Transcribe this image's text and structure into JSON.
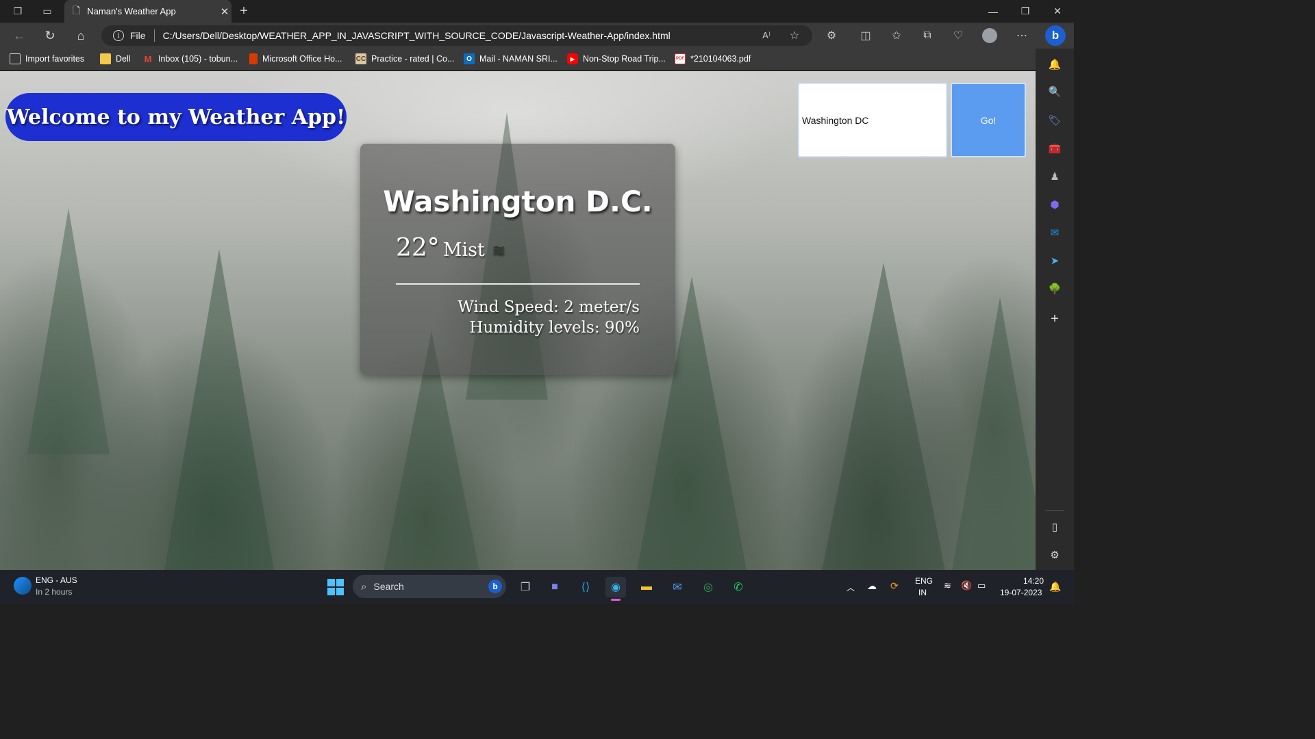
{
  "browser": {
    "tab_title": "Naman's Weather App",
    "address_scheme": "File",
    "url": "C:/Users/Dell/Desktop/WEATHER_APP_IN_JAVASCRIPT_WITH_SOURCE_CODE/Javascript-Weather-App/index.html",
    "favorites": [
      {
        "label": "Import favorites",
        "icon": "import-icon",
        "color": "#cfcfcf"
      },
      {
        "label": "Dell",
        "icon": "folder-icon",
        "color": "#f2c94c"
      },
      {
        "label": "Inbox (105) - tobun...",
        "icon": "gmail-icon",
        "color": "#ea4335"
      },
      {
        "label": "Microsoft Office Ho...",
        "icon": "office-icon",
        "color": "#d83b01"
      },
      {
        "label": "Practice - rated | Co...",
        "icon": "codechef-icon",
        "color": "#8b6b4a"
      },
      {
        "label": "Mail - NAMAN SRI...",
        "icon": "outlook-icon",
        "color": "#0f6cbd"
      },
      {
        "label": "Non-Stop Road Trip...",
        "icon": "youtube-icon",
        "color": "#ff0000"
      },
      {
        "label": "*210104063.pdf",
        "icon": "pdf-icon",
        "color": "#d32f2f"
      }
    ]
  },
  "app": {
    "welcome": "Welcome to my Weather App!",
    "search_value": "Washington DC",
    "go_label": "Go!",
    "city": "Washington D.C.",
    "temp": "22°",
    "description": "Mist",
    "weather_icon": "mist-icon",
    "wind": "Wind Speed: 2 meter/s",
    "humidity": "Humidity levels: 90%"
  },
  "taskbar": {
    "weather_label": "ENG - AUS",
    "weather_sub": "In 2 hours",
    "search_label": "Search",
    "lang_top": "ENG",
    "lang_bottom": "IN",
    "time": "14:20",
    "date": "19-07-2023"
  }
}
